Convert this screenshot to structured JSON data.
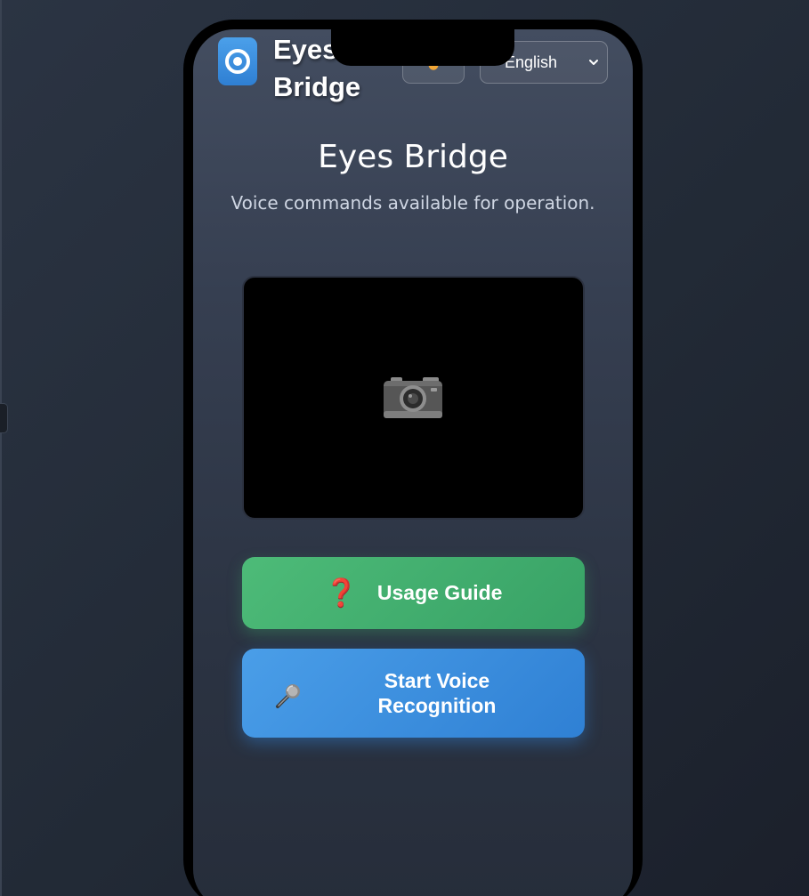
{
  "header": {
    "app_name": "Eyes Bridge",
    "language": "English"
  },
  "main": {
    "title": "Eyes Bridge",
    "subtitle": "Voice commands available for operation."
  },
  "buttons": {
    "guide_icon": "❓",
    "guide_label": "Usage Guide",
    "voice_label": "Start Voice Recognition"
  },
  "icons": {
    "logo": "target-icon",
    "theme": "sun-icon",
    "camera": "camera-icon",
    "guide": "question-mark-icon",
    "voice": "microphone-icon",
    "select": "chevron-down-icon"
  },
  "colors": {
    "guide_button": "#45b06f",
    "voice_button": "#3b8fdd",
    "logo": "#3a8ee0"
  }
}
